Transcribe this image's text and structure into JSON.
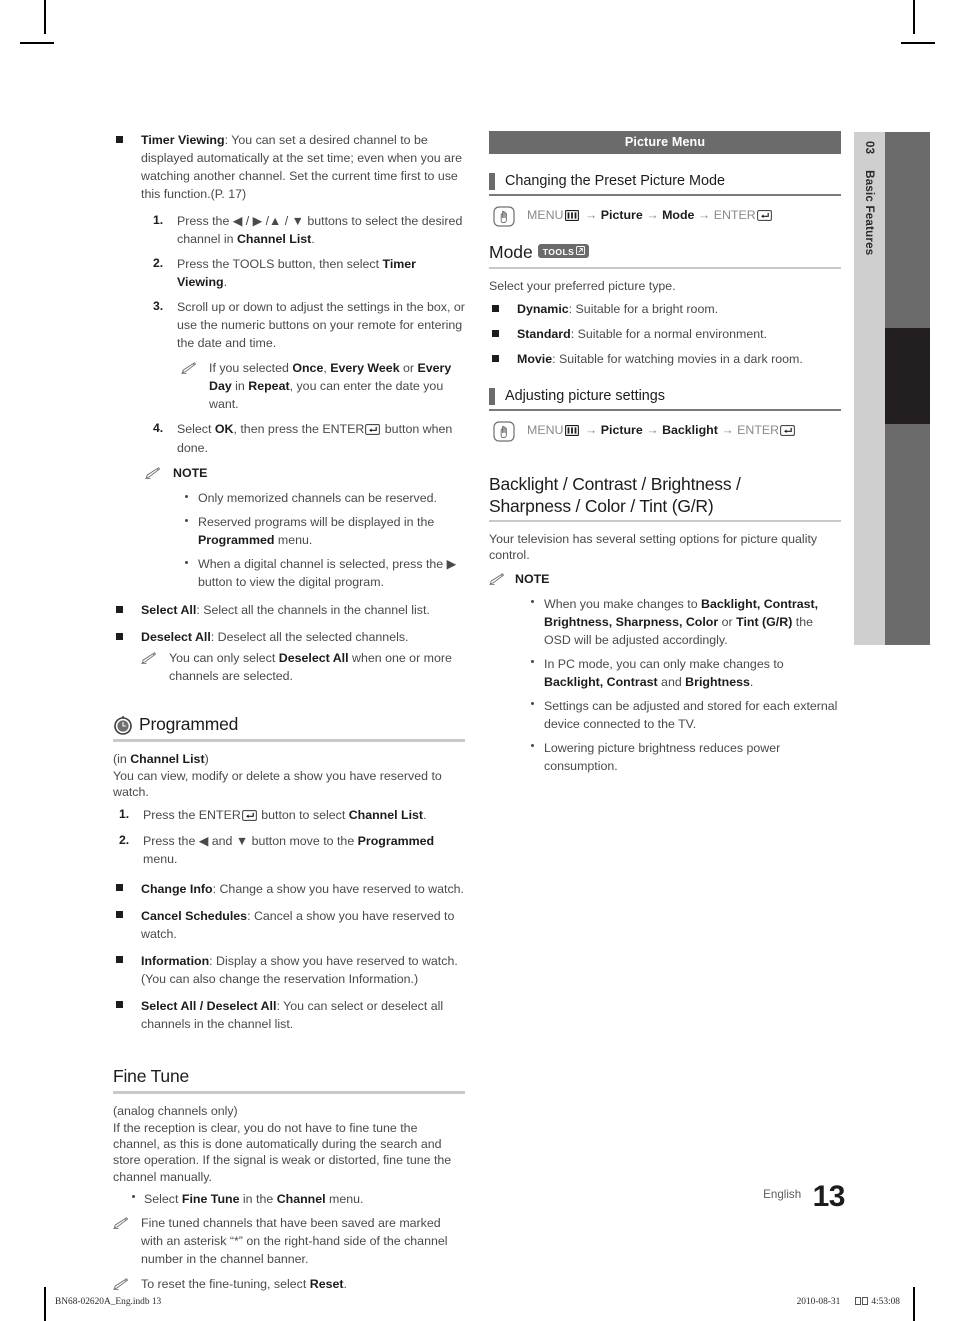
{
  "document": {
    "chapter_number": "03",
    "chapter_title": "Basic Features",
    "page_number": "13",
    "language_label": "English",
    "print_footer_left": "BN68-02620A_Eng.indb   13",
    "print_footer_right_date": "2010-08-31",
    "print_footer_right_time": "4:53:08"
  },
  "left_column": {
    "timer_viewing": {
      "term": "Timer Viewing",
      "desc": ": You can set a desired channel to be displayed automatically at the set time; even when you are watching another channel. Set the current time first to use this function.(P. 17)",
      "steps": [
        {
          "num": "1.",
          "html": "Press the ◀ / ▶ /▲ / ▼ buttons to select the desired channel in <b>Channel List</b>."
        },
        {
          "num": "2.",
          "html": "Press the TOOLS button, then select <b>Timer Viewing</b>."
        },
        {
          "num": "3.",
          "html": "Scroll up or down to adjust the settings in the box, or use the numeric buttons on your remote for entering the date and time."
        },
        {
          "num": "4.",
          "html": "Select <b>OK</b>, then press the ENTER<span class=\"enterkey\" data-name=\"enter-key-icon\"></span> button when done."
        }
      ],
      "step3_note": "If you selected <b>Once</b>, <b>Every Week</b> or <b>Every Day</b> in <b>Repeat</b>, you can enter the date you want.",
      "note_label": "NOTE",
      "notes": [
        "Only memorized channels can be reserved.",
        "Reserved programs will be displayed in the <b>Programmed</b> menu.",
        "When a digital channel is selected, press the ▶ button to view the digital program."
      ]
    },
    "select_all": {
      "term": "Select All",
      "desc": ": Select all the channels in the channel list."
    },
    "deselect_all": {
      "term": "Deselect All",
      "desc": ": Deselect all the selected channels."
    },
    "deselect_all_note": "You can only select <b>Deselect All</b> when one or more channels are selected.",
    "programmed": {
      "heading": "Programmed",
      "subtitle": "(in <b>Channel List</b>)",
      "intro": "You can view, modify or delete a show you have reserved to watch.",
      "steps": [
        {
          "num": "1.",
          "html": "Press the ENTER<span class=\"enterkey\" data-name=\"enter-key-icon\"></span> button to select <b>Channel List</b>."
        },
        {
          "num": "2.",
          "html": "Press the ◀ and ▼ button move to the <b>Programmed</b> menu."
        }
      ],
      "items": [
        {
          "term": "Change Info",
          "desc": ": Change a show you have reserved to watch."
        },
        {
          "term": "Cancel Schedules",
          "desc": ": Cancel a show you have reserved to watch."
        },
        {
          "term": "Information",
          "desc": ": Display a show you have reserved to watch. (You can also change the reservation Information.)"
        },
        {
          "term": "Select All / Deselect All",
          "desc": ": You can select or deselect all channels in the channel list."
        }
      ]
    },
    "fine_tune": {
      "heading": "Fine Tune",
      "subtitle": "(analog channels only)",
      "body": "If the reception is clear, you do not have to fine tune the channel, as this is done automatically during the search and store operation. If the signal is weak or distorted, fine tune the channel manually.",
      "bullet": "Select <b>Fine Tune</b> in the <b>Channel</b> menu.",
      "notes": [
        "Fine tuned channels that have been saved are marked with an asterisk “*” on the right-hand side of the channel number in the channel banner.",
        "To reset the fine-tuning, select <b>Reset</b>."
      ]
    }
  },
  "right_column": {
    "banner": "Picture Menu",
    "section_preset": {
      "heading": "Changing the Preset Picture Mode",
      "nav": "MENU<span class=\"menukey\" data-name=\"menu-key-icon\"></span> → <b>Picture</b> → <b>Mode</b> → ENTER<span class=\"enterkey\" data-name=\"enter-key-icon\"></span>",
      "mode_title": "Mode",
      "tools_badge": "TOOLS",
      "mode_intro": "Select your preferred picture type.",
      "modes": [
        {
          "term": "Dynamic",
          "desc": ": Suitable for a bright room."
        },
        {
          "term": "Standard",
          "desc": ": Suitable for a normal environment."
        },
        {
          "term": "Movie",
          "desc": ": Suitable for watching movies in a dark room."
        }
      ]
    },
    "section_adjust": {
      "heading": "Adjusting picture settings",
      "nav": "MENU<span class=\"menukey\" data-name=\"menu-key-icon\"></span> → <b>Picture</b> → <b>Backlight</b> → ENTER<span class=\"enterkey\" data-name=\"enter-key-icon\"></span>",
      "title_line1": "Backlight / Contrast / Brightness /",
      "title_line2": "Sharpness / Color / Tint (G/R)",
      "body": "Your television has several setting options for picture quality control.",
      "note_label": "NOTE",
      "notes": [
        "When you make changes to <b>Backlight, Contrast, Brightness, Sharpness, Color</b> or <b>Tint (G/R)</b> the OSD will be adjusted accordingly.",
        "In PC mode, you can only make changes to <b>Backlight, Contrast</b> and <b>Brightness</b>.",
        "Settings can be adjusted and stored for each external device connected to the TV.",
        "Lowering picture brightness reduces power consumption."
      ]
    }
  },
  "colors": {
    "banner_gray": "#6b6b6b",
    "tab_light": "#cfcfcf",
    "tab_dark": "#6b6b6b",
    "tab_active": "#231f20",
    "rule_gray": "#c9c9c9"
  }
}
